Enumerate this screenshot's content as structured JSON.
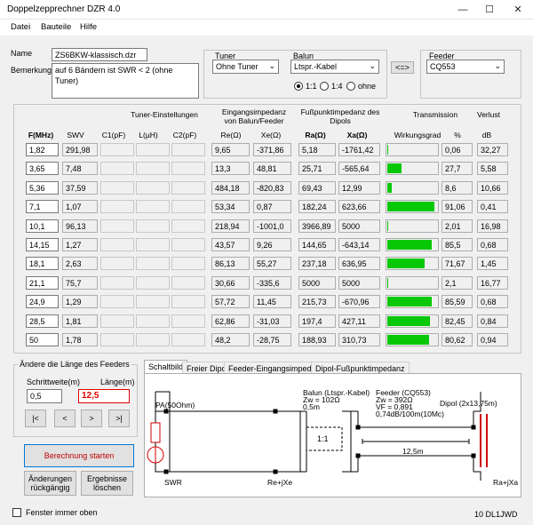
{
  "window": {
    "title": "Doppelzepprechner DZR 4.0"
  },
  "menu": [
    "Datei",
    "Bauteile",
    "Hilfe"
  ],
  "name": {
    "label": "Name",
    "value": "ZS6BKW-klassisch.dzr"
  },
  "remark": {
    "label": "Bemerkung",
    "value": "auf 6 Bändern ist SWR < 2 (ohne Tuner)"
  },
  "tuner": {
    "label": "Tuner",
    "value": "Ohne Tuner"
  },
  "balun": {
    "label": "Balun",
    "value": "Ltspr.-Kabel",
    "options": [
      "1:1",
      "1:4",
      "ohne"
    ],
    "selected": "1:1"
  },
  "swap_button": "<=>",
  "feeder": {
    "label": "Feeder",
    "value": "CQ553"
  },
  "table": {
    "group_headers": {
      "tuner": "Tuner-Einstellungen",
      "input_imp": "Eingangsimpedanz\nvon Balun/Feeder",
      "feed_imp": "Fußpunktimpedanz des\nDipols",
      "transmission": "Transmission",
      "loss": "Verlust"
    },
    "columns": [
      "F(MHz)",
      "SWV",
      "C1(pF)",
      "L(µH)",
      "C2(pF)",
      "Re(Ω)",
      "Xe(Ω)",
      "Ra(Ω)",
      "Xa(Ω)",
      "Wirkungsgrad",
      "%",
      "dB"
    ],
    "rows": [
      {
        "f": "1,82",
        "swv": "291,98",
        "re": "9,65",
        "xe": "-371,86",
        "ra": "5,18",
        "xa": "-1761,42",
        "pct": "0,06",
        "db": "32,27",
        "eff": 0.0006
      },
      {
        "f": "3,65",
        "swv": "7,48",
        "re": "13,3",
        "xe": "48,81",
        "ra": "25,71",
        "xa": "-565,64",
        "pct": "27,7",
        "db": "5,58",
        "eff": 0.277
      },
      {
        "f": "5,36",
        "swv": "37,59",
        "re": "484,18",
        "xe": "-820,83",
        "ra": "69,43",
        "xa": "12,99",
        "pct": "8,6",
        "db": "10,66",
        "eff": 0.086
      },
      {
        "f": "7,1",
        "swv": "1,07",
        "re": "53,34",
        "xe": "0,87",
        "ra": "182,24",
        "xa": "623,66",
        "pct": "91,06",
        "db": "0,41",
        "eff": 0.9106
      },
      {
        "f": "10,1",
        "swv": "96,13",
        "re": "218,94",
        "xe": "-1001,0",
        "ra": "3966,89",
        "xa": "5000",
        "pct": "2,01",
        "db": "16,98",
        "eff": 0.0201
      },
      {
        "f": "14,15",
        "swv": "1,27",
        "re": "43,57",
        "xe": "9,26",
        "ra": "144,65",
        "xa": "-643,14",
        "pct": "85,5",
        "db": "0,68",
        "eff": 0.855
      },
      {
        "f": "18,1",
        "swv": "2,63",
        "re": "86,13",
        "xe": "55,27",
        "ra": "237,18",
        "xa": "636,95",
        "pct": "71,67",
        "db": "1,45",
        "eff": 0.7167
      },
      {
        "f": "21,1",
        "swv": "75,7",
        "re": "30,66",
        "xe": "-335,6",
        "ra": "5000",
        "xa": "5000",
        "pct": "2,1",
        "db": "16,77",
        "eff": 0.021
      },
      {
        "f": "24,9",
        "swv": "1,29",
        "re": "57,72",
        "xe": "11,45",
        "ra": "215,73",
        "xa": "-670,96",
        "pct": "85,59",
        "db": "0,68",
        "eff": 0.8559
      },
      {
        "f": "28,5",
        "swv": "1,81",
        "re": "62,86",
        "xe": "-31,03",
        "ra": "197,4",
        "xa": "427,11",
        "pct": "82,45",
        "db": "0,84",
        "eff": 0.8245
      },
      {
        "f": "50",
        "swv": "1,78",
        "re": "48,2",
        "xe": "-28,75",
        "ra": "188,93",
        "xa": "310,73",
        "pct": "80,62",
        "db": "0,94",
        "eff": 0.8062
      }
    ]
  },
  "feeder_length": {
    "title": "Ändere die Länge des Feeders",
    "step_label": "Schrittweite(m)",
    "step_value": "0,5",
    "length_label": "Länge(m)",
    "length_value": "12,5",
    "nav": [
      "|<",
      "<",
      ">",
      ">|"
    ]
  },
  "buttons": {
    "start": "Berechnung starten",
    "undo": "Änderungen\nrückgängig",
    "clear": "Ergebnisse\nlöschen"
  },
  "tabs": [
    "Schaltbild",
    "Freier Dipol",
    "Feeder-Eingangsimpedanz",
    "Dipol-Fußpunktimpedanz"
  ],
  "schematic": {
    "pa": "PA(50Ohm)",
    "swr": "SWR",
    "rexe": "Re+jXe",
    "raxa": "Ra+jXa",
    "balun_title": "Balun (Ltspr.-Kabel)",
    "balun_zw": "Zw = 102Ω",
    "balun_len": "0,5m",
    "ratio": "1:1",
    "feeder_title": "Feeder (CQ553)",
    "feeder_zw": "Zw = 392Ω",
    "feeder_vf": "VF = 0,891",
    "feeder_loss": "0,74dB/100m(10Mc)",
    "feeder_len": "12,5m",
    "dipole": "Dipol (2x13,75m)"
  },
  "footer": {
    "stay_on_top": "Fenster immer oben",
    "callsign": "10 DL1JWD"
  },
  "colors": {
    "bar": "#06c806",
    "length_red": "#e00000",
    "start_red": "#c00000"
  }
}
